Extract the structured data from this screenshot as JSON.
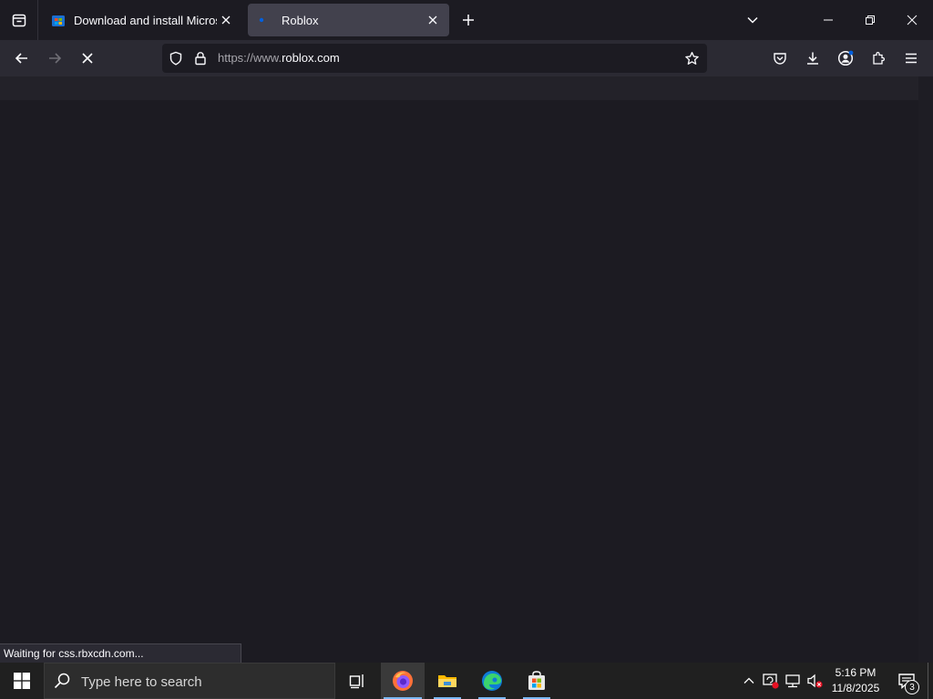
{
  "browser": {
    "tabs": [
      {
        "title": "Download and install Microsoft",
        "active": false,
        "favicon": "microsoft-store-favicon"
      },
      {
        "title": "Roblox",
        "active": true,
        "favicon": "loading-dot-favicon"
      }
    ],
    "url": {
      "prefix": "https://www.",
      "host": "roblox.com"
    },
    "status_text": "Waiting for css.rbxcdn.com...",
    "accent_color": "#0060df"
  },
  "taskbar": {
    "search_placeholder": "Type here to search",
    "clock_time": "5:16 PM",
    "clock_date": "11/8/2025",
    "notification_count": "3",
    "pinned_apps": [
      "firefox-icon",
      "file-explorer-icon",
      "edge-icon",
      "microsoft-store-icon"
    ]
  },
  "colors": {
    "tabbar_bg": "#1c1b22",
    "navbar_bg": "#2b2a33",
    "taskbar_bg": "#202020",
    "taskbar_active_underline": "#7ab8f5"
  }
}
